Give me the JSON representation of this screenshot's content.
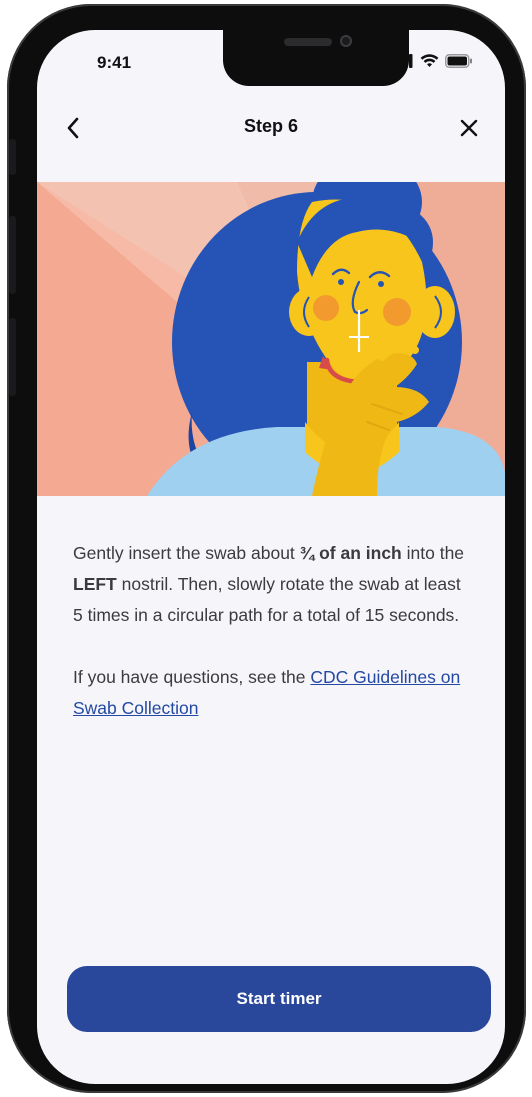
{
  "status_bar": {
    "time": "9:41"
  },
  "header": {
    "title": "Step 6",
    "back_icon": "chevron-left-icon",
    "close_icon": "close-icon"
  },
  "illustration": {
    "alt": "person-swabbing-nose-illustration"
  },
  "instructions": {
    "p1_pre": "Gently insert the swab about ",
    "p1_bold1": "¾ of an inch",
    "p1_mid": " into the ",
    "p1_bold2": "LEFT",
    "p1_post": " nostril. Then, slowly rotate the swab at least 5 times in a circular path for a total of 15 seconds.",
    "p2_pre": "If you have questions, see the ",
    "p2_link": "CDC Guidelines on Swab Collection"
  },
  "cta": {
    "label": "Start timer"
  },
  "colors": {
    "primary": "#29489b",
    "link": "#2349a3",
    "background": "#f6f5fa",
    "illustration_bg": "#f4a992",
    "hair": "#2553b6",
    "skin": "#f7c51c"
  }
}
